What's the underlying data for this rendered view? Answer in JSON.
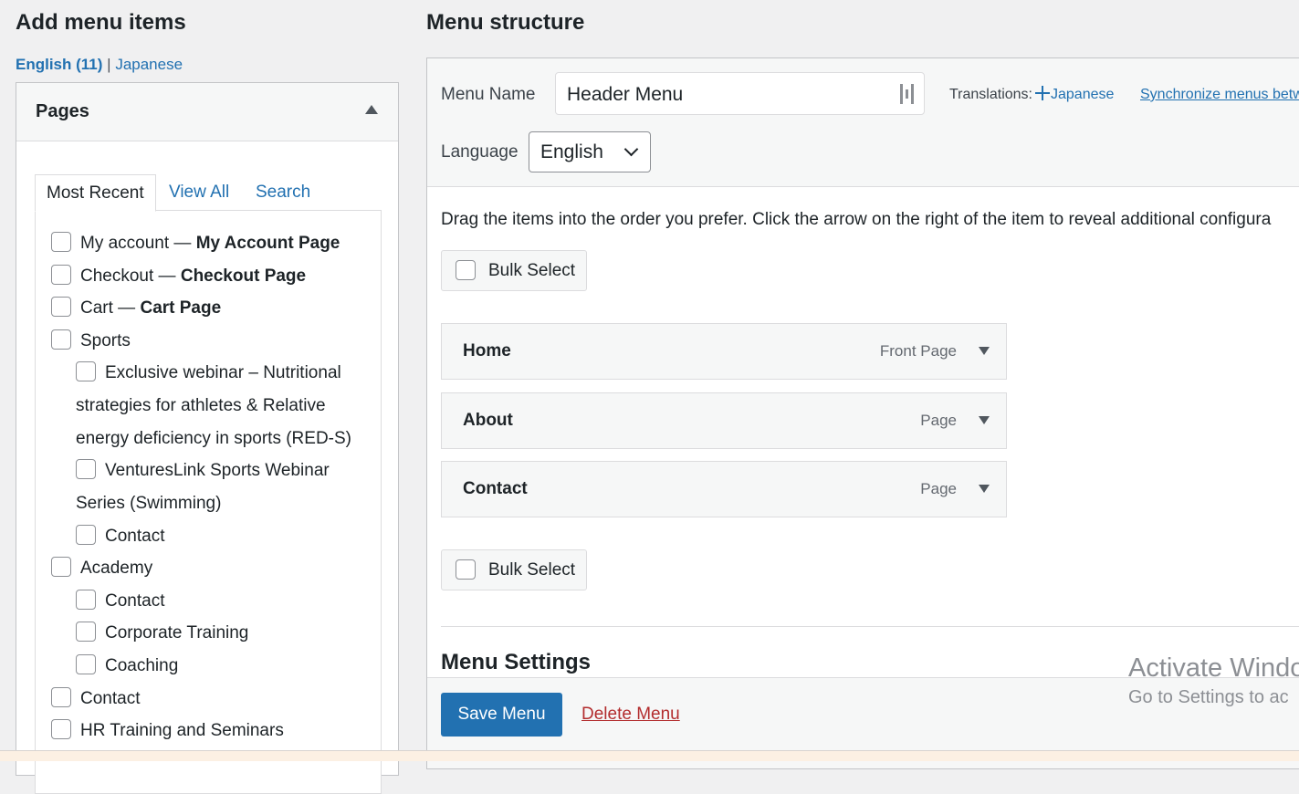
{
  "left": {
    "title": "Add menu items",
    "languages": {
      "current": "English (11)",
      "separator": "|",
      "other": "Japanese"
    },
    "pages_box": {
      "title": "Pages",
      "tabs": [
        "Most Recent",
        "View All",
        "Search"
      ],
      "items": [
        {
          "title": "My account",
          "dash": " — ",
          "state": "My Account Page"
        },
        {
          "title": "Checkout",
          "dash": " — ",
          "state": "Checkout Page"
        },
        {
          "title": "Cart",
          "dash": " — ",
          "state": "Cart Page"
        },
        {
          "title": "Sports"
        },
        {
          "lines": [
            "Exclusive webinar – Nutritional",
            "strategies for athletes & Relative",
            "energy deficiency in sports (RED-S)"
          ]
        },
        {
          "lines": [
            "VenturesLink Sports Webinar",
            "Series (Swimming)"
          ]
        },
        {
          "title": "Contact"
        },
        {
          "title": "Academy"
        },
        {
          "title": "Contact"
        },
        {
          "title": "Corporate Training"
        },
        {
          "title": "Coaching"
        },
        {
          "title": "Contact"
        },
        {
          "title": "HR Training and Seminars"
        }
      ]
    }
  },
  "right": {
    "title": "Menu structure",
    "menu_name_label": "Menu Name",
    "menu_name_value": "Header Menu",
    "translations_label": "Translations:",
    "translation_link": "Japanese",
    "sync_link": "Synchronize menus betw",
    "language_label": "Language",
    "language_value": "English",
    "drag_instructions": "Drag the items into the order you prefer. Click the arrow on the right of the item to reveal additional configura",
    "bulk_select": "Bulk Select",
    "menu_items": [
      {
        "name": "Home",
        "type": "Front Page"
      },
      {
        "name": "About",
        "type": "Page"
      },
      {
        "name": "Contact",
        "type": "Page"
      }
    ],
    "settings_title": "Menu Settings",
    "save_button": "Save Menu",
    "delete_link": "Delete Menu"
  },
  "watermark": {
    "line1": "Activate Windo",
    "line2": "Go to Settings to ac"
  },
  "colors": {
    "accent": "#2271b1",
    "danger": "#b32d2e",
    "background": "#f0f0f1",
    "panel_header": "#f6f7f7"
  }
}
